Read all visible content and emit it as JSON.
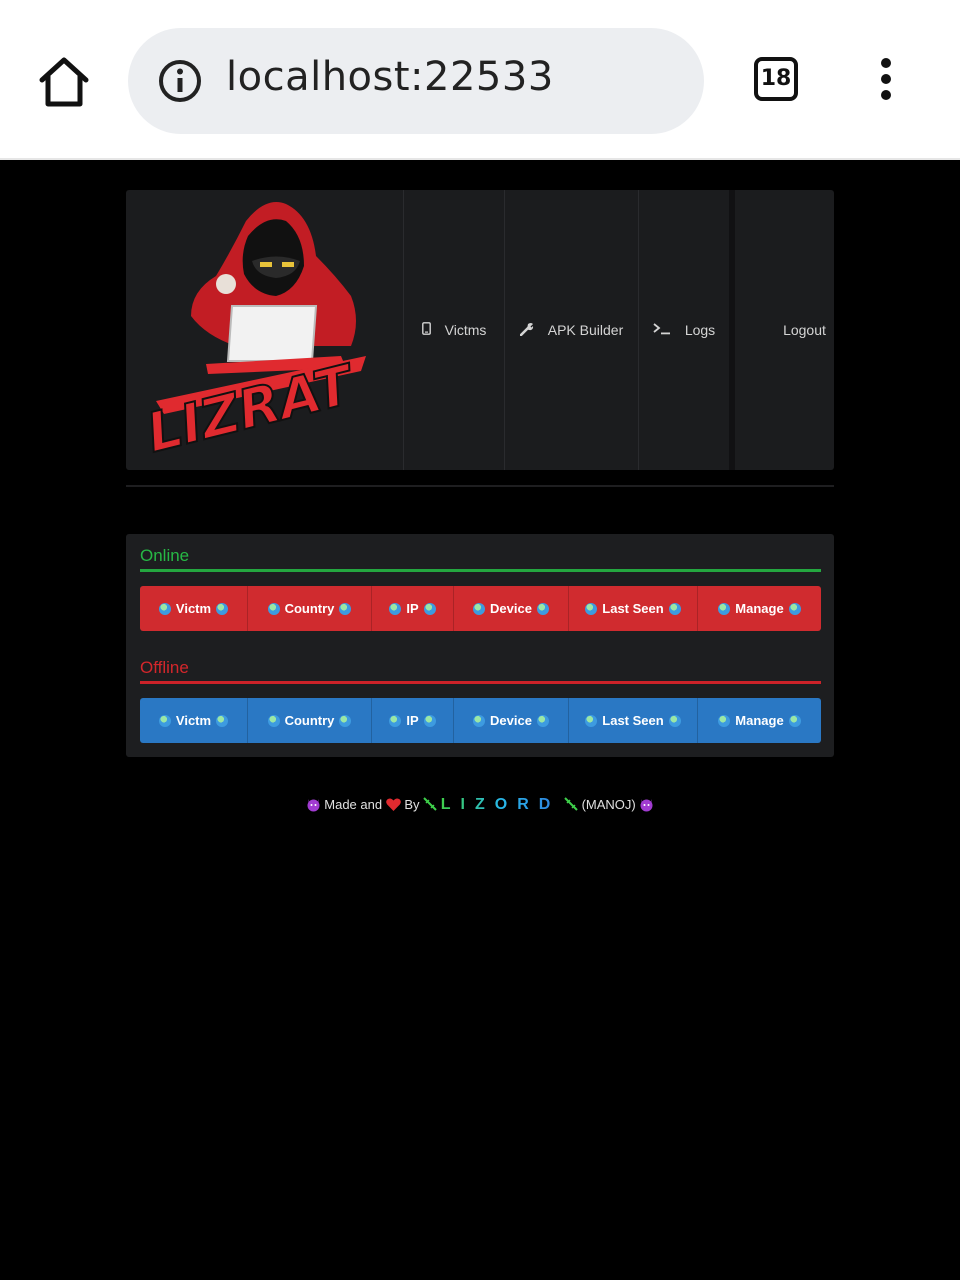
{
  "browser": {
    "url": "localhost:22533",
    "tab_count": "18"
  },
  "header": {
    "logo_text": "LIZRAT",
    "nav": [
      {
        "label": "Victms",
        "icon": "phone-icon"
      },
      {
        "label": "APK Builder",
        "icon": "wrench-icon"
      },
      {
        "label": "Logs",
        "icon": "terminal-icon"
      },
      {
        "label": "Logout",
        "icon": ""
      }
    ]
  },
  "online": {
    "title": "Online",
    "columns": [
      "Victm",
      "Country",
      "IP",
      "Device",
      "Last Seen",
      "Manage"
    ]
  },
  "offline": {
    "title": "Offline",
    "columns": [
      "Victm",
      "Country",
      "IP",
      "Device",
      "Last Seen",
      "Manage"
    ]
  },
  "footer": {
    "made_and": "Made and",
    "by": "By",
    "author": "LIZORD",
    "name": "(MANOJ)"
  },
  "colors": {
    "online_accent": "#27b845",
    "offline_accent": "#d3262b",
    "online_header_bg": "#d02b2f",
    "offline_header_bg": "#2a78c4",
    "panel_bg": "#1d1e20"
  }
}
